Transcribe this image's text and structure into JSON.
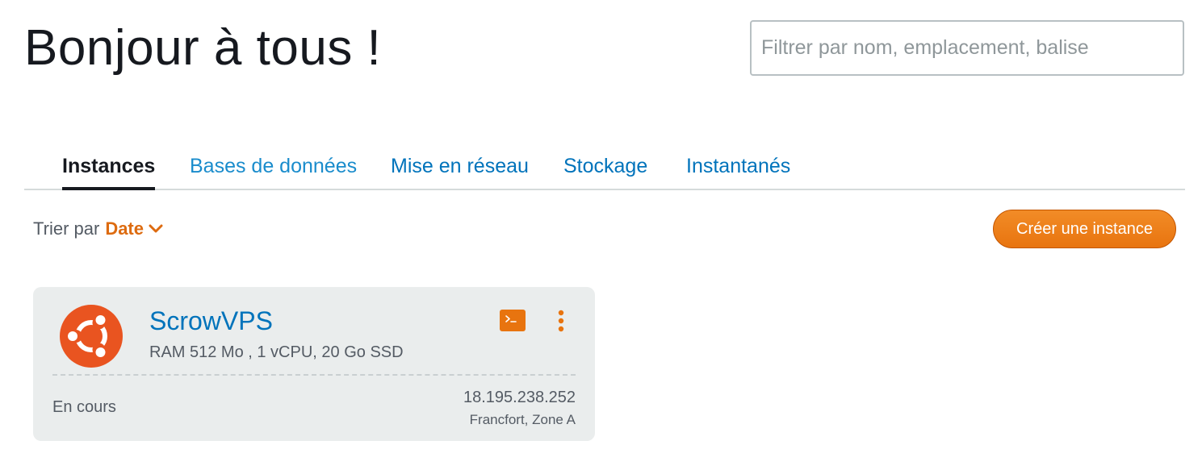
{
  "header": {
    "greeting": "Bonjour à tous !",
    "search_placeholder": "Filtrer par nom, emplacement, balise"
  },
  "tabs": [
    {
      "label": "Instances",
      "active": true
    },
    {
      "label": "Bases de données",
      "active": false
    },
    {
      "label": "Mise en réseau",
      "active": false
    },
    {
      "label": "Stockage",
      "active": false
    },
    {
      "label": "Instantanés",
      "active": false
    }
  ],
  "sort": {
    "prefix": "Trier par",
    "value": "Date"
  },
  "actions": {
    "create_instance_label": "Créer une instance"
  },
  "instance": {
    "name": "ScrowVPS",
    "specs": "RAM 512 Mo , 1 vCPU, 20 Go SSD",
    "status": "En cours",
    "ip": "18.195.238.252",
    "location": "Francfort, Zone A",
    "os_icon": "ubuntu-icon"
  },
  "colors": {
    "accent_orange": "#e8740f",
    "link_blue": "#0073bb",
    "ubuntu_orange": "#e95420",
    "card_bg": "#eaeded"
  }
}
